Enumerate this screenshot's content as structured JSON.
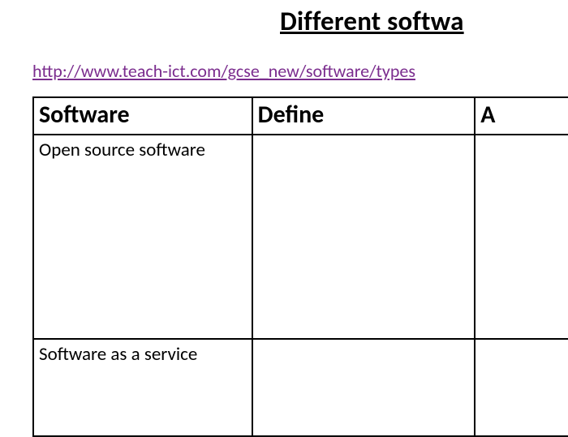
{
  "title": "Different softwa",
  "link_url": "http://www.teach-ict.com/gcse_new/software/types",
  "table": {
    "headers": {
      "col1": "Software",
      "col2": "Define",
      "col3": "A"
    },
    "rows": [
      {
        "software": "Open source software",
        "define": "",
        "third": ""
      },
      {
        "software": "Software as a service",
        "define": "",
        "third": ""
      }
    ]
  }
}
